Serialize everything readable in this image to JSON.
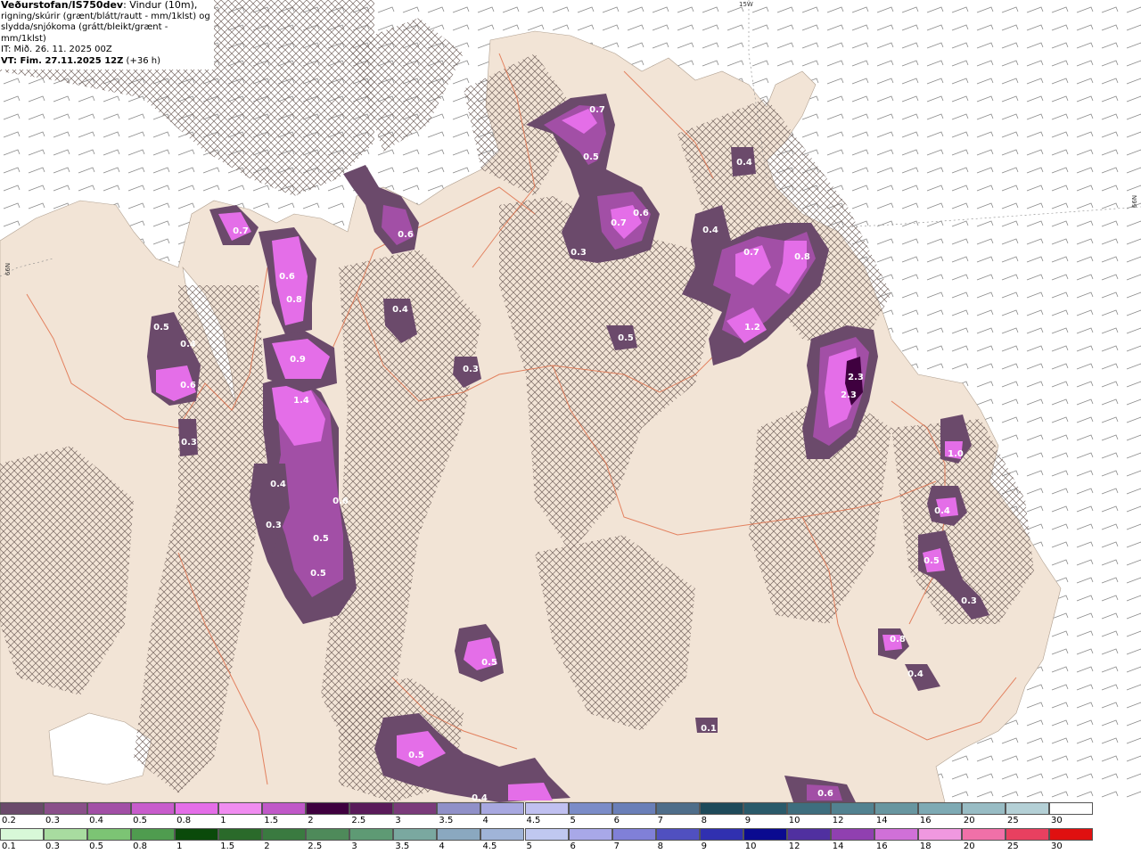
{
  "header": {
    "title_bold": "Veðurstofan/IS750dev",
    "title_rest": ": Vindur (10m),",
    "line2": "rigning/skúrir (grænt/blátt/rautt - mm/1klst) og",
    "line3": "slydda/snjókoma (grátt/bleikt/grænt - mm/1klst)",
    "line4": "IT: Mið. 26. 11. 2025 00Z",
    "line5_bold": "VT: Fim. 27.11.2025 12Z",
    "line5_rest": " (+36 h)"
  },
  "coords": {
    "top": "15W",
    "left": "66N",
    "right": "66N"
  },
  "precip_labels": [
    {
      "text": "0.7"
    },
    {
      "text": "0.5"
    },
    {
      "text": "0.7"
    },
    {
      "text": "0.6"
    },
    {
      "text": "0.3"
    },
    {
      "text": "0.4"
    },
    {
      "text": "0.6"
    },
    {
      "text": "0.7"
    },
    {
      "text": "0.8"
    },
    {
      "text": "1.2"
    },
    {
      "text": "0.4"
    },
    {
      "text": "2.3"
    },
    {
      "text": "2.3"
    },
    {
      "text": "0.5"
    },
    {
      "text": "0.3"
    },
    {
      "text": "0.7"
    },
    {
      "text": "0.6"
    },
    {
      "text": "0.6"
    },
    {
      "text": "0.8"
    },
    {
      "text": "0.9"
    },
    {
      "text": "1.4"
    },
    {
      "text": "0.4"
    },
    {
      "text": "0.6"
    },
    {
      "text": "0.3"
    },
    {
      "text": "0.5"
    },
    {
      "text": "0.5"
    },
    {
      "text": "0.5"
    },
    {
      "text": "0.4"
    },
    {
      "text": "0.6"
    },
    {
      "text": "0.3"
    },
    {
      "text": "0.4"
    },
    {
      "text": "0.3"
    },
    {
      "text": "1.0"
    },
    {
      "text": "0.4"
    },
    {
      "text": "0.5"
    },
    {
      "text": "0.3"
    },
    {
      "text": "0.8"
    },
    {
      "text": "0.4"
    },
    {
      "text": "0.5"
    },
    {
      "text": "0.4"
    },
    {
      "text": "0.1"
    },
    {
      "text": "0.5"
    },
    {
      "text": "0.6"
    }
  ],
  "legend_snow": {
    "labels": [
      "0.2",
      "0.3",
      "0.4",
      "0.5",
      "0.8",
      "1",
      "1.5",
      "2",
      "2.5",
      "3",
      "3.5",
      "4",
      "4.5",
      "5",
      "6",
      "7",
      "8",
      "9",
      "10",
      "12",
      "14",
      "16",
      "20",
      "25",
      "30"
    ],
    "colors": [
      "#6b4a6b",
      "#8a4f8a",
      "#a24fa6",
      "#c85ccc",
      "#e46ee8",
      "#f08cf0",
      "#c058c8",
      "#3f003f",
      "#5a1a5a",
      "#7a3a7a",
      "#9090c8",
      "#a8a8e0",
      "#c0c0f0",
      "#7b8cc8",
      "#6a7fb8",
      "#4f6e8a",
      "#1e4a5a",
      "#2a5a6a",
      "#3e6e7e",
      "#528290",
      "#6896a0",
      "#7eaab4",
      "#98bcc4",
      "#b4d0d6",
      "#ffffff"
    ]
  },
  "legend_rain": {
    "labels": [
      "0.1",
      "0.3",
      "0.5",
      "0.8",
      "1",
      "1.5",
      "2",
      "2.5",
      "3",
      "3.5",
      "4",
      "4.5",
      "5",
      "6",
      "7",
      "8",
      "9",
      "10",
      "12",
      "14",
      "16",
      "18",
      "20",
      "25",
      "30"
    ],
    "colors": [
      "#d8f8d8",
      "#a8dca0",
      "#7cc474",
      "#4f9c4f",
      "#0a4a0a",
      "#2a6a2a",
      "#3a7a40",
      "#4e8a5a",
      "#5e9a74",
      "#7aa8a0",
      "#8aa8c0",
      "#a0b4d8",
      "#c0c8f0",
      "#a8a8e8",
      "#8080d8",
      "#5050c0",
      "#3030b0",
      "#0a0a90",
      "#5030a0",
      "#9040b0",
      "#d070d8",
      "#f098e0",
      "#f070a8",
      "#e84060",
      "#e01010"
    ]
  }
}
